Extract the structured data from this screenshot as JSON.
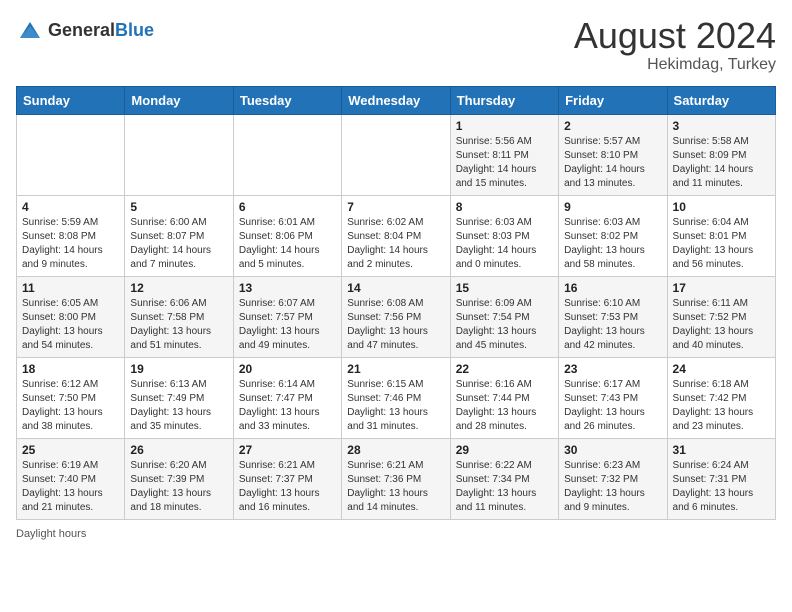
{
  "header": {
    "logo_general": "General",
    "logo_blue": "Blue",
    "month_title": "August 2024",
    "subtitle": "Hekimdag, Turkey"
  },
  "days_of_week": [
    "Sunday",
    "Monday",
    "Tuesday",
    "Wednesday",
    "Thursday",
    "Friday",
    "Saturday"
  ],
  "footer": {
    "daylight_label": "Daylight hours"
  },
  "weeks": [
    {
      "cells": [
        {
          "day": null,
          "info": null
        },
        {
          "day": null,
          "info": null
        },
        {
          "day": null,
          "info": null
        },
        {
          "day": null,
          "info": null
        },
        {
          "day": "1",
          "info": "Sunrise: 5:56 AM\nSunset: 8:11 PM\nDaylight: 14 hours\nand 15 minutes."
        },
        {
          "day": "2",
          "info": "Sunrise: 5:57 AM\nSunset: 8:10 PM\nDaylight: 14 hours\nand 13 minutes."
        },
        {
          "day": "3",
          "info": "Sunrise: 5:58 AM\nSunset: 8:09 PM\nDaylight: 14 hours\nand 11 minutes."
        }
      ]
    },
    {
      "cells": [
        {
          "day": "4",
          "info": "Sunrise: 5:59 AM\nSunset: 8:08 PM\nDaylight: 14 hours\nand 9 minutes."
        },
        {
          "day": "5",
          "info": "Sunrise: 6:00 AM\nSunset: 8:07 PM\nDaylight: 14 hours\nand 7 minutes."
        },
        {
          "day": "6",
          "info": "Sunrise: 6:01 AM\nSunset: 8:06 PM\nDaylight: 14 hours\nand 5 minutes."
        },
        {
          "day": "7",
          "info": "Sunrise: 6:02 AM\nSunset: 8:04 PM\nDaylight: 14 hours\nand 2 minutes."
        },
        {
          "day": "8",
          "info": "Sunrise: 6:03 AM\nSunset: 8:03 PM\nDaylight: 14 hours\nand 0 minutes."
        },
        {
          "day": "9",
          "info": "Sunrise: 6:03 AM\nSunset: 8:02 PM\nDaylight: 13 hours\nand 58 minutes."
        },
        {
          "day": "10",
          "info": "Sunrise: 6:04 AM\nSunset: 8:01 PM\nDaylight: 13 hours\nand 56 minutes."
        }
      ]
    },
    {
      "cells": [
        {
          "day": "11",
          "info": "Sunrise: 6:05 AM\nSunset: 8:00 PM\nDaylight: 13 hours\nand 54 minutes."
        },
        {
          "day": "12",
          "info": "Sunrise: 6:06 AM\nSunset: 7:58 PM\nDaylight: 13 hours\nand 51 minutes."
        },
        {
          "day": "13",
          "info": "Sunrise: 6:07 AM\nSunset: 7:57 PM\nDaylight: 13 hours\nand 49 minutes."
        },
        {
          "day": "14",
          "info": "Sunrise: 6:08 AM\nSunset: 7:56 PM\nDaylight: 13 hours\nand 47 minutes."
        },
        {
          "day": "15",
          "info": "Sunrise: 6:09 AM\nSunset: 7:54 PM\nDaylight: 13 hours\nand 45 minutes."
        },
        {
          "day": "16",
          "info": "Sunrise: 6:10 AM\nSunset: 7:53 PM\nDaylight: 13 hours\nand 42 minutes."
        },
        {
          "day": "17",
          "info": "Sunrise: 6:11 AM\nSunset: 7:52 PM\nDaylight: 13 hours\nand 40 minutes."
        }
      ]
    },
    {
      "cells": [
        {
          "day": "18",
          "info": "Sunrise: 6:12 AM\nSunset: 7:50 PM\nDaylight: 13 hours\nand 38 minutes."
        },
        {
          "day": "19",
          "info": "Sunrise: 6:13 AM\nSunset: 7:49 PM\nDaylight: 13 hours\nand 35 minutes."
        },
        {
          "day": "20",
          "info": "Sunrise: 6:14 AM\nSunset: 7:47 PM\nDaylight: 13 hours\nand 33 minutes."
        },
        {
          "day": "21",
          "info": "Sunrise: 6:15 AM\nSunset: 7:46 PM\nDaylight: 13 hours\nand 31 minutes."
        },
        {
          "day": "22",
          "info": "Sunrise: 6:16 AM\nSunset: 7:44 PM\nDaylight: 13 hours\nand 28 minutes."
        },
        {
          "day": "23",
          "info": "Sunrise: 6:17 AM\nSunset: 7:43 PM\nDaylight: 13 hours\nand 26 minutes."
        },
        {
          "day": "24",
          "info": "Sunrise: 6:18 AM\nSunset: 7:42 PM\nDaylight: 13 hours\nand 23 minutes."
        }
      ]
    },
    {
      "cells": [
        {
          "day": "25",
          "info": "Sunrise: 6:19 AM\nSunset: 7:40 PM\nDaylight: 13 hours\nand 21 minutes."
        },
        {
          "day": "26",
          "info": "Sunrise: 6:20 AM\nSunset: 7:39 PM\nDaylight: 13 hours\nand 18 minutes."
        },
        {
          "day": "27",
          "info": "Sunrise: 6:21 AM\nSunset: 7:37 PM\nDaylight: 13 hours\nand 16 minutes."
        },
        {
          "day": "28",
          "info": "Sunrise: 6:21 AM\nSunset: 7:36 PM\nDaylight: 13 hours\nand 14 minutes."
        },
        {
          "day": "29",
          "info": "Sunrise: 6:22 AM\nSunset: 7:34 PM\nDaylight: 13 hours\nand 11 minutes."
        },
        {
          "day": "30",
          "info": "Sunrise: 6:23 AM\nSunset: 7:32 PM\nDaylight: 13 hours\nand 9 minutes."
        },
        {
          "day": "31",
          "info": "Sunrise: 6:24 AM\nSunset: 7:31 PM\nDaylight: 13 hours\nand 6 minutes."
        }
      ]
    }
  ]
}
